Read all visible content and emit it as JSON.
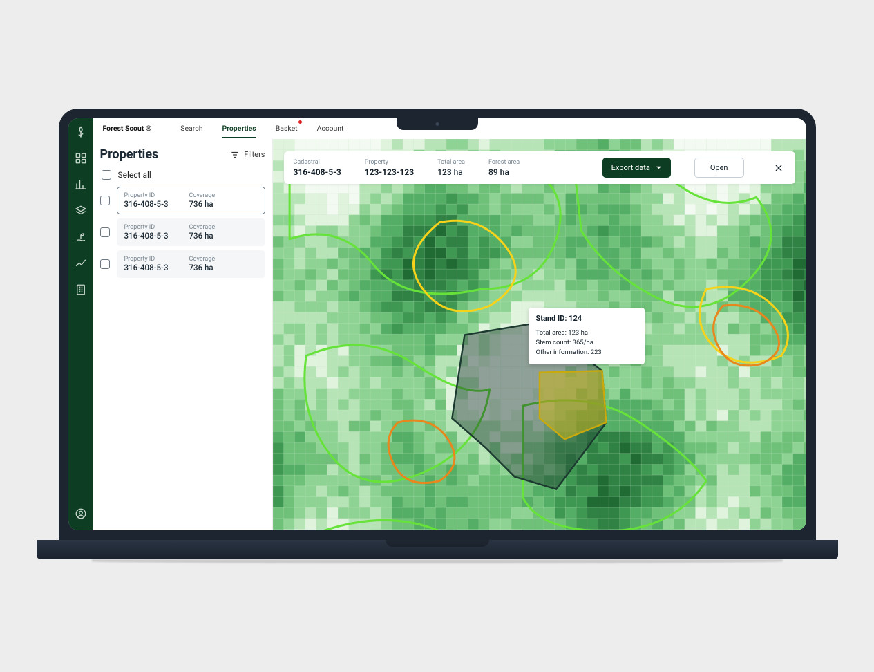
{
  "app_name": "Forest Scout ®",
  "nav": {
    "tabs": [
      "Search",
      "Properties",
      "Basket",
      "Account"
    ],
    "active_index": 1,
    "basket_badge": true
  },
  "side": {
    "title": "Properties",
    "filters_label": "Filters",
    "select_all_label": "Select all",
    "rows": [
      {
        "property_id_label": "Property ID",
        "property_id": "316-408-5-3",
        "coverage_label": "Coverage",
        "coverage": "736 ha",
        "selected": true
      },
      {
        "property_id_label": "Property ID",
        "property_id": "316-408-5-3",
        "coverage_label": "Coverage",
        "coverage": "736 ha",
        "selected": false
      },
      {
        "property_id_label": "Property ID",
        "property_id": "316-408-5-3",
        "coverage_label": "Coverage",
        "coverage": "736 ha",
        "selected": false
      }
    ]
  },
  "map_info": {
    "cadastral": {
      "label": "Cadastral",
      "value": "316-408-5-3"
    },
    "property": {
      "label": "Property",
      "value": "123-123-123"
    },
    "total_area": {
      "label": "Total area",
      "value": "123 ha"
    },
    "forest_area": {
      "label": "Forest area",
      "value": "89 ha"
    },
    "export_label": "Export data",
    "open_label": "Open"
  },
  "tooltip": {
    "title": "Stand ID: 124",
    "line1": "Total area: 123 ha",
    "line2": "Stem count: 365/ha",
    "line3": "Other information: 223"
  },
  "colors": {
    "brand_dark": "#0d3d22"
  }
}
